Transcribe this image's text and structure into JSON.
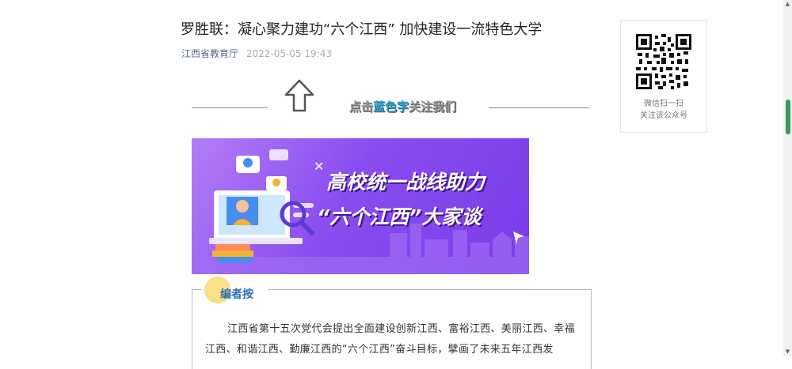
{
  "article": {
    "title": "罗胜联：凝心聚力建功“六个江西” 加快建设一流特色大学",
    "source": "江西省教育厅",
    "date": "2022-05-05 19:43"
  },
  "follow": {
    "prefix": "点击",
    "highlight": "蓝色字",
    "suffix": "关注我们"
  },
  "banner": {
    "line1": "高校统一战线助力",
    "line2": "“六个江西”大家谈"
  },
  "editor_note": {
    "label": "编者按",
    "text": "江西省第十五次党代会提出全面建设创新江西、富裕江西、美丽江西、幸福江西、和谐江西、勤廉江西的“六个江西”奋斗目标，擘画了未来五年江西发"
  },
  "qr": {
    "caption1": "微信扫一扫",
    "caption2": "关注该公众号"
  },
  "icons": [
    "arrow-up-icon",
    "qr-code-icon",
    "magnifier-icon"
  ],
  "colors": {
    "accent_blue": "#23a3d8",
    "source_link": "#576b95",
    "banner_purple": "#8a4cf0"
  }
}
